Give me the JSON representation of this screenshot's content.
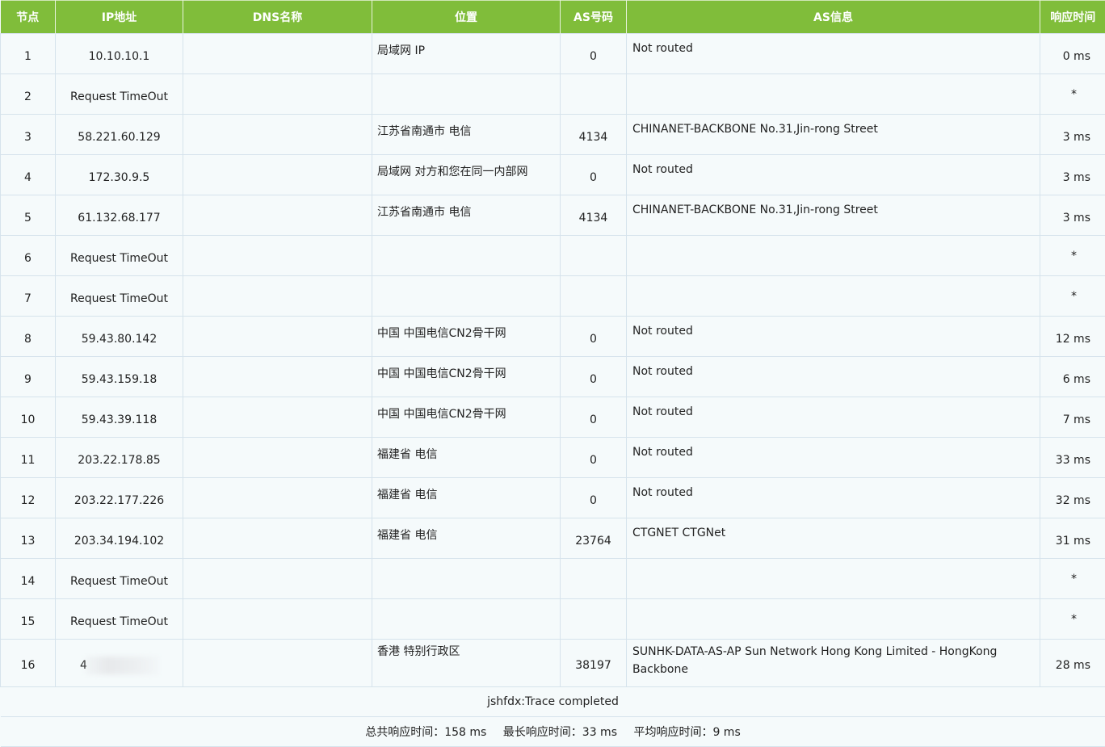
{
  "headers": [
    "节点",
    "IP地址",
    "DNS名称",
    "位置",
    "AS号码",
    "AS信息",
    "响应时间"
  ],
  "rows": [
    {
      "hop": "1",
      "ip": "10.10.10.1",
      "dns": "",
      "loc": "局域网 IP",
      "asn": "0",
      "asinfo": "Not routed",
      "rt": "0 ms"
    },
    {
      "hop": "2",
      "ip": "Request TimeOut",
      "dns": "",
      "loc": "",
      "asn": "",
      "asinfo": "",
      "rt": "*"
    },
    {
      "hop": "3",
      "ip": "58.221.60.129",
      "dns": "",
      "loc": "江苏省南通市 电信",
      "asn": "4134",
      "asinfo": "CHINANET-BACKBONE No.31,Jin-rong Street",
      "rt": "3 ms"
    },
    {
      "hop": "4",
      "ip": "172.30.9.5",
      "dns": "",
      "loc": "局域网 对方和您在同一内部网",
      "asn": "0",
      "asinfo": "Not routed",
      "rt": "3 ms"
    },
    {
      "hop": "5",
      "ip": "61.132.68.177",
      "dns": "",
      "loc": "江苏省南通市 电信",
      "asn": "4134",
      "asinfo": "CHINANET-BACKBONE No.31,Jin-rong Street",
      "rt": "3 ms"
    },
    {
      "hop": "6",
      "ip": "Request TimeOut",
      "dns": "",
      "loc": "",
      "asn": "",
      "asinfo": "",
      "rt": "*"
    },
    {
      "hop": "7",
      "ip": "Request TimeOut",
      "dns": "",
      "loc": "",
      "asn": "",
      "asinfo": "",
      "rt": "*"
    },
    {
      "hop": "8",
      "ip": "59.43.80.142",
      "dns": "",
      "loc": "中国 中国电信CN2骨干网",
      "asn": "0",
      "asinfo": "Not routed",
      "rt": "12 ms"
    },
    {
      "hop": "9",
      "ip": "59.43.159.18",
      "dns": "",
      "loc": "中国 中国电信CN2骨干网",
      "asn": "0",
      "asinfo": "Not routed",
      "rt": "6 ms"
    },
    {
      "hop": "10",
      "ip": "59.43.39.118",
      "dns": "",
      "loc": "中国 中国电信CN2骨干网",
      "asn": "0",
      "asinfo": "Not routed",
      "rt": "7 ms"
    },
    {
      "hop": "11",
      "ip": "203.22.178.85",
      "dns": "",
      "loc": "福建省 电信",
      "asn": "0",
      "asinfo": "Not routed",
      "rt": "33 ms"
    },
    {
      "hop": "12",
      "ip": "203.22.177.226",
      "dns": "",
      "loc": "福建省 电信",
      "asn": "0",
      "asinfo": "Not routed",
      "rt": "32 ms"
    },
    {
      "hop": "13",
      "ip": "203.34.194.102",
      "dns": "",
      "loc": "福建省 电信",
      "asn": "23764",
      "asinfo": "CTGNET CTGNet",
      "rt": "31 ms"
    },
    {
      "hop": "14",
      "ip": "Request TimeOut",
      "dns": "",
      "loc": "",
      "asn": "",
      "asinfo": "",
      "rt": "*"
    },
    {
      "hop": "15",
      "ip": "Request TimeOut",
      "dns": "",
      "loc": "",
      "asn": "",
      "asinfo": "",
      "rt": "*"
    },
    {
      "hop": "16",
      "ip": "4",
      "dns": "",
      "loc": "香港 特别行政区",
      "asn": "38197",
      "asinfo": "SUNHK-DATA-AS-AP Sun Network Hong Kong Limited - HongKong Backbone",
      "rt": "28 ms",
      "blurred": true
    }
  ],
  "footer": {
    "status": "jshfdx:Trace completed",
    "total_label": "总共响应时间：",
    "total_value": "158 ms",
    "max_label": "最长响应时间：",
    "max_value": "33 ms",
    "avg_label": "平均响应时间：",
    "avg_value": "9 ms"
  }
}
